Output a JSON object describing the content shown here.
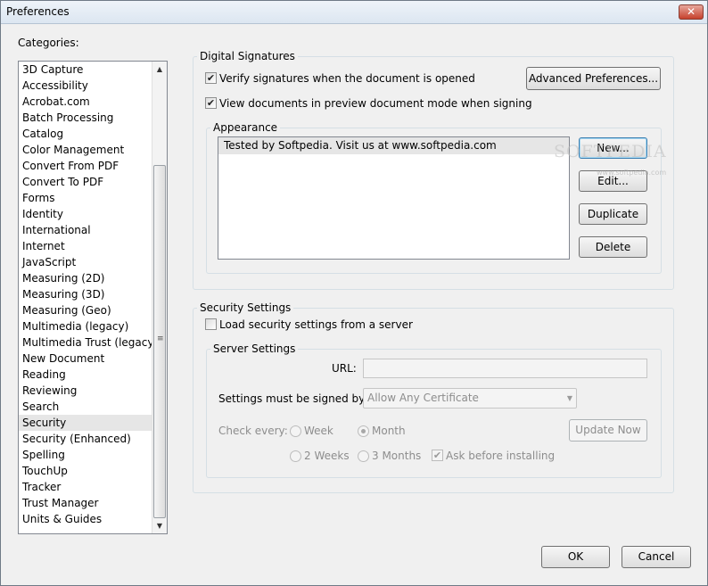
{
  "window": {
    "title": "Preferences",
    "close_glyph": "✕"
  },
  "categories": {
    "label": "Categories:",
    "selected": "Security",
    "items": [
      "3D Capture",
      "Accessibility",
      "Acrobat.com",
      "Batch Processing",
      "Catalog",
      "Color Management",
      "Convert From PDF",
      "Convert To PDF",
      "Forms",
      "Identity",
      "International",
      "Internet",
      "JavaScript",
      "Measuring (2D)",
      "Measuring (3D)",
      "Measuring (Geo)",
      "Multimedia (legacy)",
      "Multimedia Trust (legacy)",
      "New Document",
      "Reading",
      "Reviewing",
      "Search",
      "Security",
      "Security (Enhanced)",
      "Spelling",
      "TouchUp",
      "Tracker",
      "Trust Manager",
      "Units & Guides"
    ]
  },
  "digital_signatures": {
    "title": "Digital Signatures",
    "verify_label": "Verify signatures when the document is opened",
    "verify_checked": true,
    "preview_label": "View documents in preview document mode when signing",
    "preview_checked": true,
    "advanced_button": "Advanced Preferences...",
    "appearance": {
      "title": "Appearance",
      "items": [
        "Tested by Softpedia. Visit us at www.softpedia.com"
      ],
      "new_button": "New...",
      "edit_button": "Edit...",
      "duplicate_button": "Duplicate",
      "delete_button": "Delete"
    }
  },
  "security_settings": {
    "title": "Security Settings",
    "load_label": "Load security settings from a server",
    "load_checked": false,
    "server_settings": {
      "title": "Server Settings",
      "url_label": "URL:",
      "url_value": "",
      "signed_by_label": "Settings must be signed by:",
      "signed_by_value": "Allow Any Certificate",
      "check_every_label": "Check every:",
      "options": {
        "week": "Week",
        "month": "Month",
        "two_weeks": "2 Weeks",
        "three_months": "3 Months"
      },
      "selected_interval": "Month",
      "ask_label": "Ask before installing",
      "ask_checked": true,
      "update_button": "Update Now"
    }
  },
  "footer": {
    "ok_button": "OK",
    "cancel_button": "Cancel"
  },
  "watermark": {
    "text": "SOFTPEDIA",
    "subtext": "www.softpedia.com"
  },
  "icons": {
    "check": "✔",
    "scroll_up": "▲",
    "scroll_down": "▼",
    "grip": "≡",
    "dropdown": "▼"
  }
}
